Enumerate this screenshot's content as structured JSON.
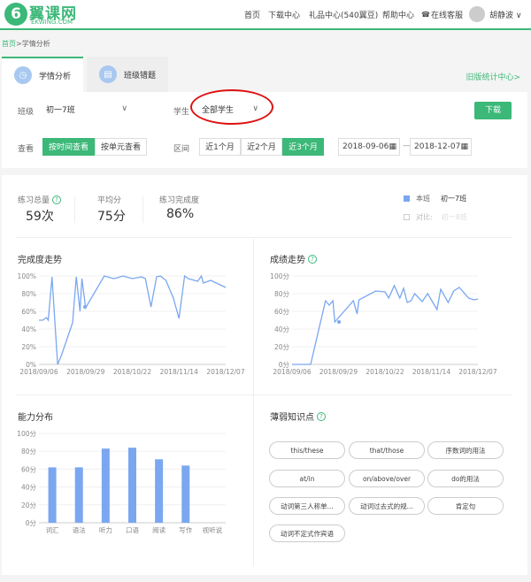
{
  "header": {
    "logo_mark": "6",
    "logo_text": "翼课网",
    "logo_sub": "EKWING.COM",
    "nav": [
      "首页",
      "下载中心",
      "礼品中心(540翼豆)",
      "帮助中心"
    ],
    "online_service": "在线客服",
    "user_name": "胡静波 ∨"
  },
  "breadcrumb": {
    "home": "首页",
    "current": ">学情分析"
  },
  "tabs": [
    {
      "label": "学情分析"
    },
    {
      "label": "班级错题"
    }
  ],
  "old_stats_link": "旧版统计中心>",
  "filters": {
    "class_label": "班级",
    "class_value": "初一7班",
    "student_label": "学生",
    "student_value": "全部学生",
    "download": "下载",
    "view_label": "查看",
    "view_options": [
      "按时间查看",
      "按单元查看"
    ],
    "range_label": "区间",
    "range_options": [
      "近1个月",
      "近2个月",
      "近3个月"
    ],
    "date_from": "2018-09-06",
    "date_sep": "—",
    "date_to": "2018-12-07",
    "calendar_icon": "calendar-icon"
  },
  "stats": [
    {
      "label": "练习总量",
      "value": "59次"
    },
    {
      "label": "平均分",
      "value": "75分"
    },
    {
      "label": "练习完成度",
      "value": "86%"
    }
  ],
  "legend": {
    "this_class_label": "本班",
    "this_class_value": "初一7班",
    "compare_label": "对比:",
    "compare_value": "初一8班",
    "this_class_color": "#7aa7f0"
  },
  "completion_chart": {
    "title": "完成度走势",
    "y_ticks": [
      "100%",
      "80%",
      "60%",
      "40%",
      "20%",
      "0%"
    ],
    "x_ticks": [
      "2018/09/06",
      "2018/09/29",
      "2018/10/22",
      "2018/11/14",
      "2018/12/07"
    ]
  },
  "score_chart": {
    "title": "成绩走势",
    "y_ticks": [
      "100分",
      "80分",
      "60分",
      "40分",
      "20分",
      "0分"
    ],
    "x_ticks": [
      "2018/09/06",
      "2018/09/29",
      "2018/10/22",
      "2018/11/14",
      "2018/12/07"
    ]
  },
  "ability_chart": {
    "title": "能力分布",
    "y_ticks": [
      "100分",
      "80分",
      "60分",
      "40分",
      "20分",
      "0分"
    ]
  },
  "weak_points": {
    "title": "薄弱知识点",
    "items": [
      "this/these",
      "that/those",
      "序数词的用法",
      "at/in",
      "on/above/over",
      "do的用法",
      "动词第三人称单...",
      "动词过去式的规...",
      "肯定句",
      "动词不定式作宾语"
    ]
  },
  "chart_data": [
    {
      "type": "line",
      "title": "完成度走势",
      "x_ticks": [
        "2018/09/06",
        "2018/09/29",
        "2018/10/22",
        "2018/11/14",
        "2018/12/07"
      ],
      "ylim": [
        0,
        100
      ],
      "x": [
        0,
        0.02,
        0.04,
        0.05,
        0.07,
        0.1,
        0.12,
        0.18,
        0.2,
        0.22,
        0.23,
        0.25,
        0.35,
        0.4,
        0.42,
        0.45,
        0.5,
        0.55,
        0.57,
        0.6,
        0.63,
        0.65,
        0.68,
        0.72,
        0.75,
        0.78,
        0.8,
        0.85,
        0.87,
        0.88,
        0.92,
        0.97,
        1.0
      ],
      "values": [
        50,
        50,
        53,
        50,
        99,
        0,
        10,
        47,
        99,
        60,
        97,
        64,
        100,
        97,
        98,
        100,
        97,
        99,
        97,
        65,
        99,
        100,
        95,
        75,
        52,
        100,
        97,
        94,
        100,
        92,
        95,
        90,
        87
      ],
      "color": "#7aa7f0"
    },
    {
      "type": "line",
      "title": "成绩走势",
      "x_ticks": [
        "2018/09/06",
        "2018/09/29",
        "2018/10/22",
        "2018/11/14",
        "2018/12/07"
      ],
      "ylim": [
        0,
        100
      ],
      "x": [
        0,
        0.1,
        0.18,
        0.2,
        0.22,
        0.23,
        0.28,
        0.33,
        0.35,
        0.36,
        0.45,
        0.5,
        0.52,
        0.55,
        0.58,
        0.6,
        0.62,
        0.64,
        0.66,
        0.7,
        0.73,
        0.78,
        0.8,
        0.84,
        0.87,
        0.9,
        0.95,
        0.98,
        1.0
      ],
      "values": [
        0,
        0,
        72,
        67,
        72,
        48,
        60,
        72,
        57,
        73,
        83,
        82,
        75,
        89,
        75,
        86,
        70,
        72,
        80,
        71,
        80,
        62,
        85,
        70,
        83,
        87,
        75,
        73,
        74
      ],
      "color": "#7aa7f0"
    },
    {
      "type": "bar",
      "title": "能力分布",
      "categories": [
        "词汇",
        "语法",
        "听力",
        "口语",
        "阅读",
        "写作",
        "视听说"
      ],
      "values": [
        62,
        62,
        83,
        84,
        71,
        64,
        0
      ],
      "ylim": [
        0,
        100
      ],
      "color": "#7aa7f0"
    }
  ]
}
